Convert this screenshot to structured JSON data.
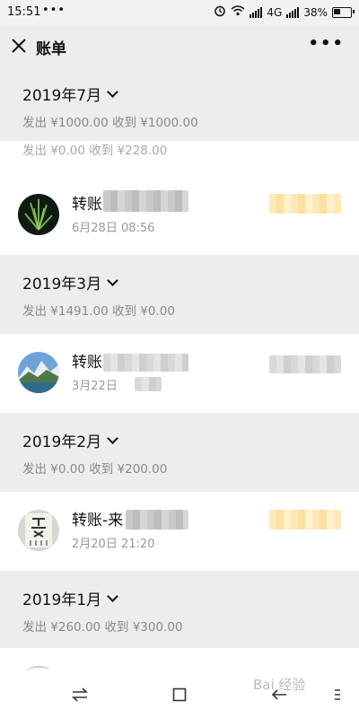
{
  "status": {
    "time": "15:51",
    "dots": "•••",
    "network": "4G",
    "battery": "38%"
  },
  "header": {
    "title": "账单",
    "more": "•••"
  },
  "sections": [
    {
      "month": "2019年7月",
      "summary": "发出 ¥1000.00 收到 ¥1000.00"
    },
    {
      "month": "2019年3月",
      "summary": "发出 ¥1491.00 收到 ¥0.00"
    },
    {
      "month": "2019年2月",
      "summary": "发出 ¥0.00 收到 ¥200.00"
    },
    {
      "month": "2019年1月",
      "summary": "发出 ¥260.00 收到 ¥300.00"
    }
  ],
  "peek_summary": "发出 ¥0.00 收到 ¥228.00",
  "items": [
    {
      "title": "转账",
      "date": "6月28日 08:56"
    },
    {
      "title": "转账",
      "date": "3月22日"
    },
    {
      "title": "转账-来",
      "date": "2月20日 21:20"
    }
  ],
  "watermark": "Bai 经验"
}
